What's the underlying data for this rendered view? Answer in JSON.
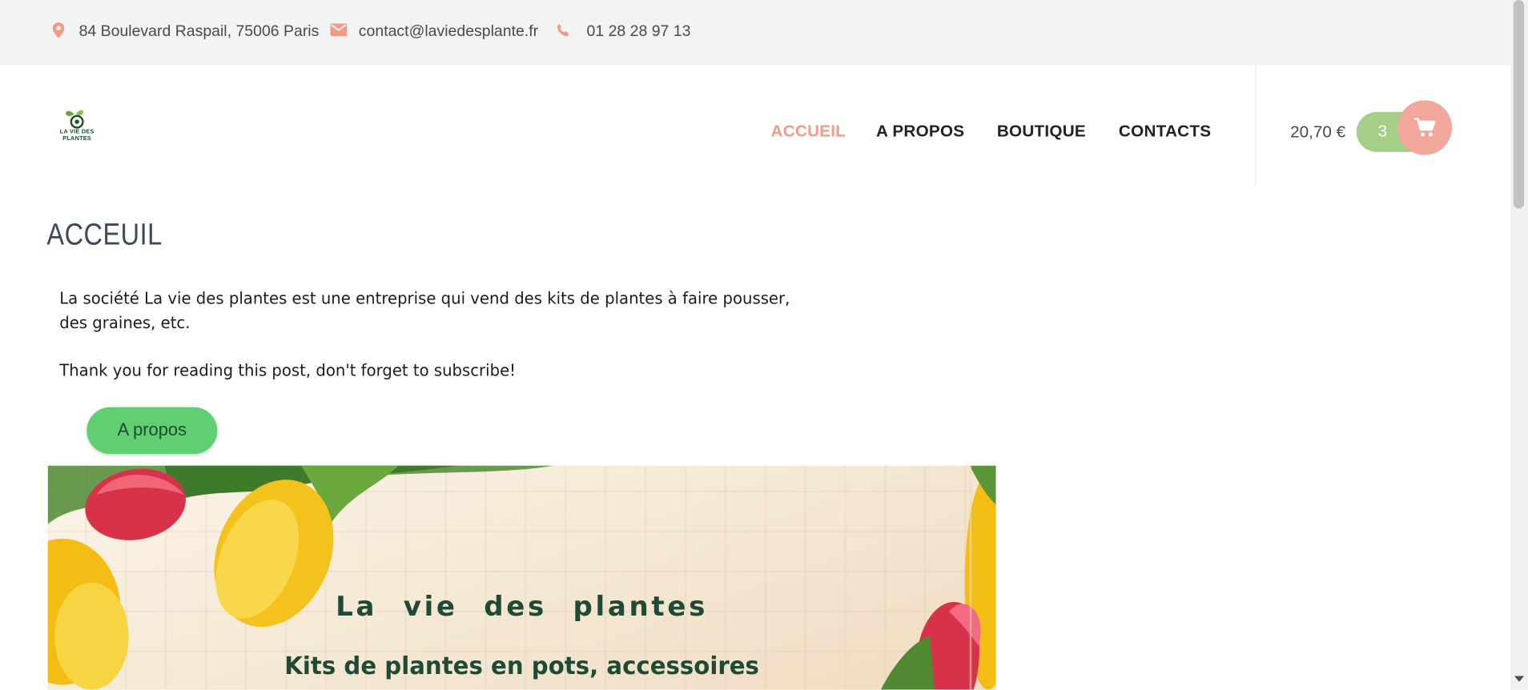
{
  "topbar": {
    "address": "84 Boulevard Raspail, 75006 Paris",
    "email": "contact@laviedesplante.fr",
    "phone": "01 28 28 97 13",
    "accent_color": "#f39a84"
  },
  "header": {
    "logo_text_line1": "LA VIE DES",
    "logo_text_line2": "PLANTES",
    "nav": [
      {
        "label": "ACCUEIL",
        "active": true
      },
      {
        "label": "A PROPOS",
        "active": false
      },
      {
        "label": "BOUTIQUE",
        "active": false
      },
      {
        "label": "CONTACTS",
        "active": false
      }
    ],
    "cart_total": "20,70 €",
    "cart_count": "3",
    "cart_icon": "shopping-cart-icon"
  },
  "main": {
    "page_title": "ACCEUIL",
    "paragraph_1_line1": "La société La vie des plantes est une entreprise qui vend des kits de plantes à faire pousser,",
    "paragraph_1_line2": "des graines, etc.",
    "paragraph_2": "Thank you for reading this post, don't forget to subscribe!",
    "button_label": "A propos"
  },
  "hero": {
    "title": "La vie des plantes",
    "subtitle": "Kits de plantes en pots, accessoires"
  },
  "colors": {
    "nav_active": "#f39a84",
    "button_green": "#5fcf72",
    "cart_count_bg": "#a5cf86",
    "cart_button_bg": "#f1a79b",
    "hero_text": "#1f4a35"
  }
}
